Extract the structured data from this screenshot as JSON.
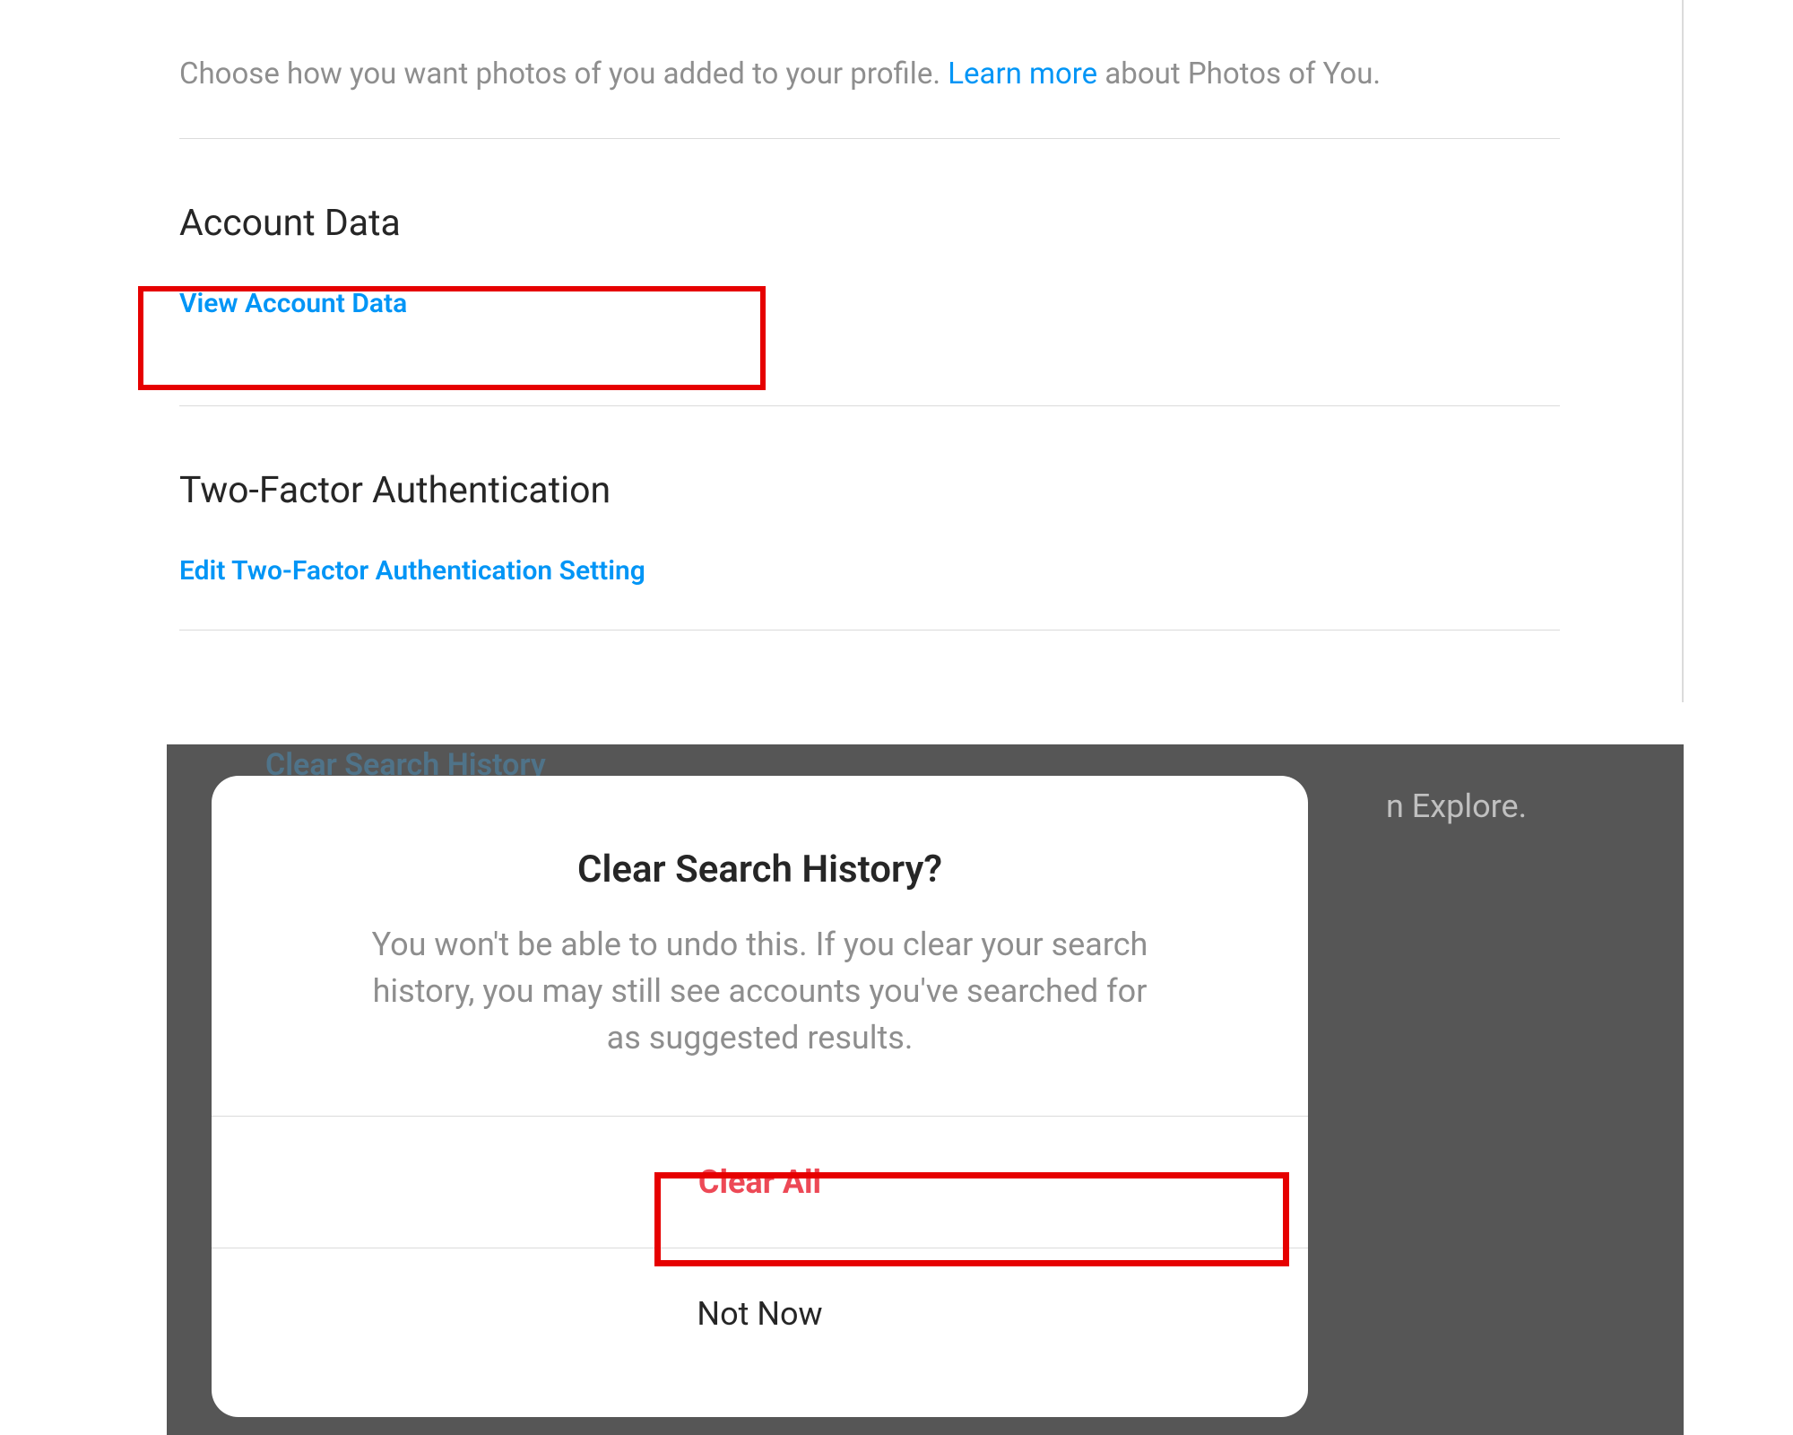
{
  "photos": {
    "description_prefix": "Choose how you want photos of you added to your profile. ",
    "learn_more_label": "Learn more",
    "description_suffix": " about Photos of You."
  },
  "sections": {
    "account_data": {
      "heading": "Account Data",
      "link": "View Account Data"
    },
    "two_factor": {
      "heading": "Two-Factor Authentication",
      "link": "Edit Two-Factor Authentication Setting"
    }
  },
  "behind": {
    "clear_search_link": "Clear Search History",
    "explore_fragment": "n Explore."
  },
  "modal": {
    "title": "Clear Search History?",
    "body": "You won't be able to undo this. If you clear your search history, you may still see accounts you've searched for as suggested results.",
    "clear_all_label": "Clear All",
    "not_now_label": "Not Now"
  }
}
